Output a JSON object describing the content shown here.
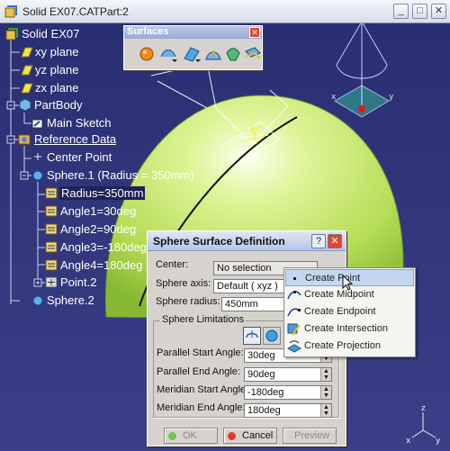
{
  "window": {
    "title": "Solid EX07.CATPart:2",
    "buttons": {
      "minimize": "_",
      "maximize": "□",
      "close": "✕"
    }
  },
  "tree": {
    "items": [
      {
        "label": "Solid EX07"
      },
      {
        "label": "xy plane"
      },
      {
        "label": "yz plane"
      },
      {
        "label": "zx plane"
      },
      {
        "label": "PartBody"
      },
      {
        "label": "Main Sketch"
      },
      {
        "label": "Reference Data"
      },
      {
        "label": "Center Point"
      },
      {
        "label": "Sphere.1 (Radius = 350mm)"
      },
      {
        "label": "Radius=350mm"
      },
      {
        "label": "Angle1=30deg"
      },
      {
        "label": "Angle2=90deg"
      },
      {
        "label": "Angle3=-180deg"
      },
      {
        "label": "Angle4=180deg"
      },
      {
        "label": "Point.2"
      },
      {
        "label": "Sphere.2"
      }
    ]
  },
  "surfaces_toolbar": {
    "title": "Surfaces",
    "close": "✕"
  },
  "dialog": {
    "title": "Sphere Surface Definition",
    "help": "?",
    "close": "✕",
    "center_label": "Center:",
    "center_value": "No selection",
    "axis_label": "Sphere axis:",
    "axis_value": "Default ( xyz )",
    "radius_label": "Sphere radius:",
    "radius_value": "450mm",
    "limitations_label": "Sphere Limitations",
    "parallel_start_label": "Parallel Start Angle:",
    "parallel_start_value": "30deg",
    "parallel_end_label": "Parallel End Angle:",
    "parallel_end_value": "90deg",
    "meridian_start_label": "Meridian Start Angle:",
    "meridian_start_value": "-180deg",
    "meridian_end_label": "Meridian End Angle:",
    "meridian_end_value": "180deg",
    "ok": "OK",
    "cancel": "Cancel",
    "preview": "Preview"
  },
  "context_menu": {
    "items": [
      {
        "label": "Create Point"
      },
      {
        "label": "Create Midpoint"
      },
      {
        "label": "Create Endpoint"
      },
      {
        "label": "Create Intersection"
      },
      {
        "label": "Create Projection"
      }
    ]
  },
  "colors": {
    "background": "#2e3278",
    "sphere": "#b8e25a",
    "highlight": "#c4d7f2"
  }
}
